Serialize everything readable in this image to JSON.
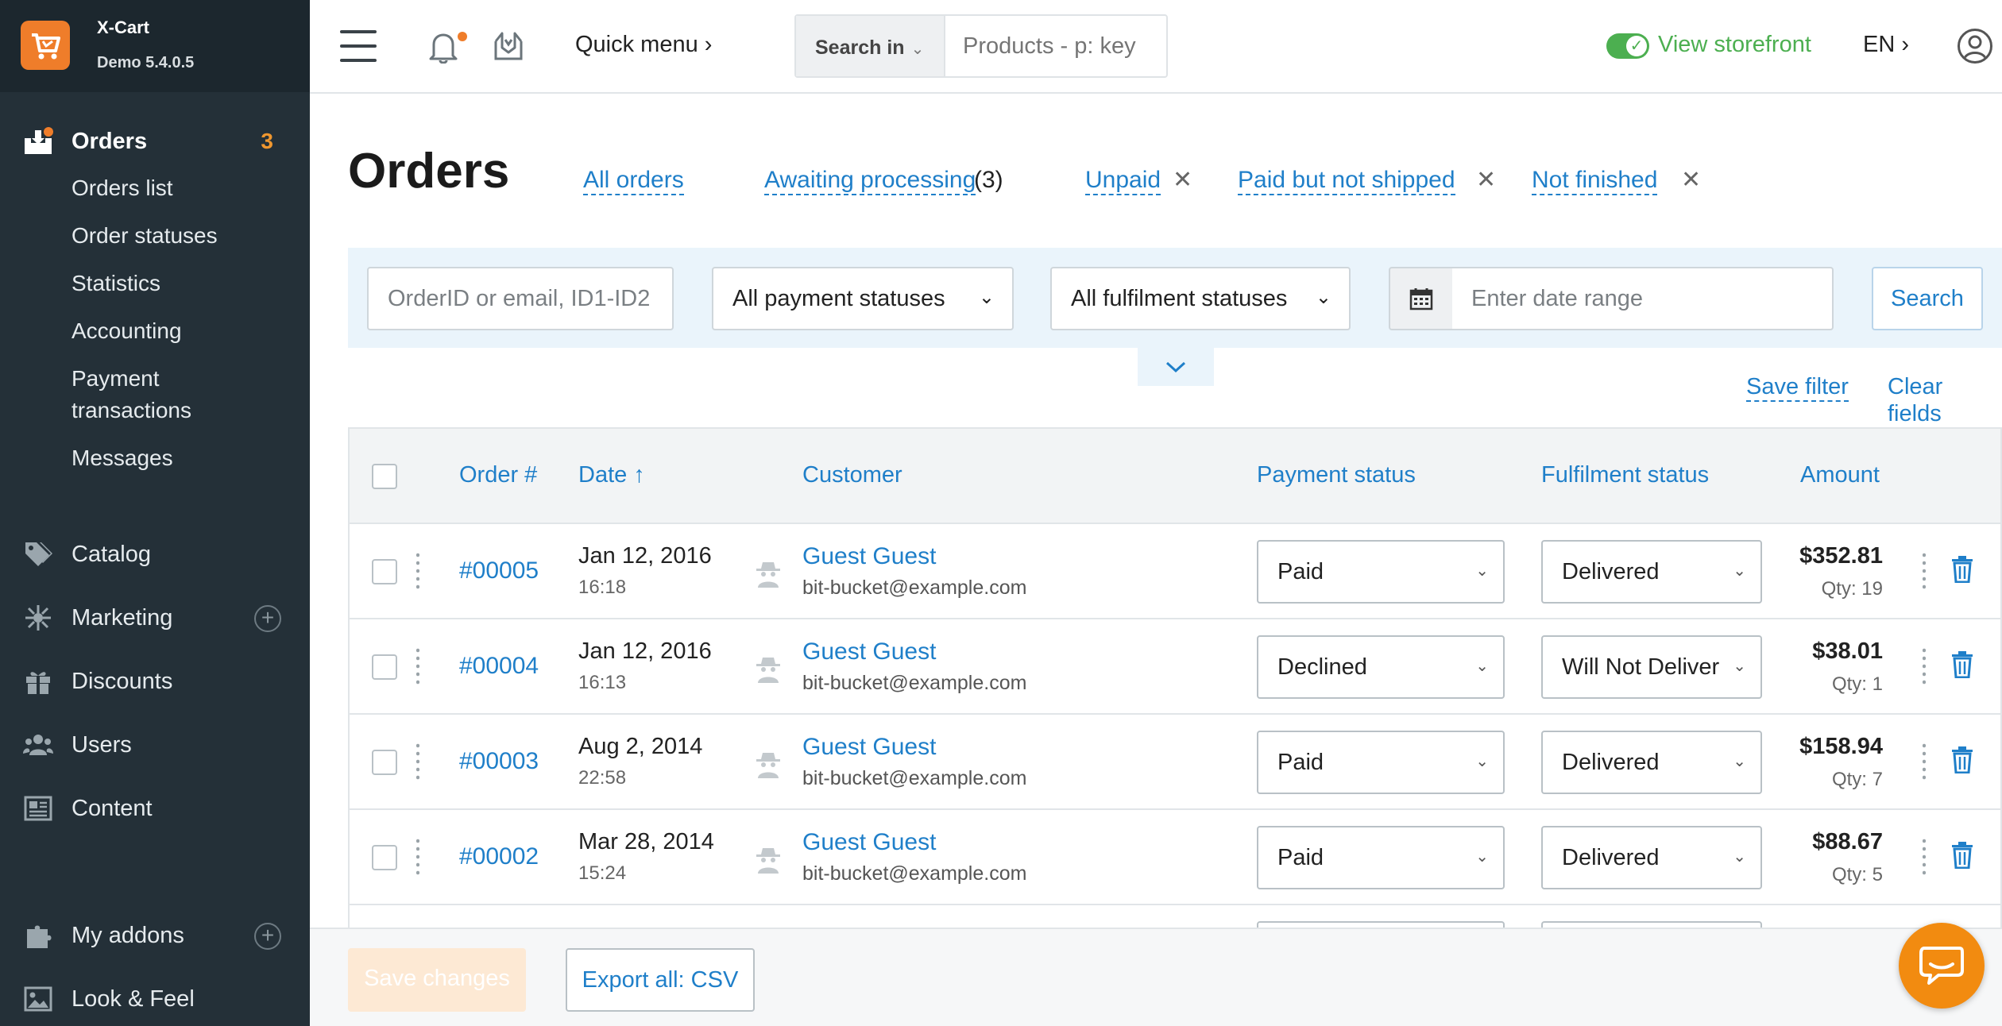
{
  "brand": {
    "name": "X-Cart",
    "version": "Demo 5.4.0.5"
  },
  "sidebar": {
    "orders": {
      "label": "Orders",
      "count": "3"
    },
    "sub_items": [
      "Orders list",
      "Order statuses",
      "Statistics",
      "Accounting",
      "Payment",
      "transactions",
      "Messages"
    ],
    "items": [
      {
        "label": "Catalog"
      },
      {
        "label": "Marketing",
        "plus": "+"
      },
      {
        "label": "Discounts"
      },
      {
        "label": "Users"
      },
      {
        "label": "Content"
      },
      {
        "label": "My addons",
        "plus": "+"
      },
      {
        "label": "Look & Feel"
      }
    ]
  },
  "topbar": {
    "quick_menu": "Quick menu ›",
    "search_in": "Search in",
    "search_caret": "⌄",
    "search_placeholder": "Products - p: key",
    "view_storefront": "View storefront",
    "lang": "EN ›"
  },
  "page": {
    "title": "Orders",
    "tabs": {
      "all": "All orders",
      "awaiting": "Awaiting processing",
      "awaiting_count": "(3)",
      "unpaid": "Unpaid",
      "paid_not_shipped": "Paid but not shipped",
      "not_finished": "Not finished",
      "close": "✕"
    }
  },
  "filters": {
    "order_placeholder": "OrderID or email, ID1-ID2",
    "payment_status": "All payment statuses",
    "fulfilment_status": "All fulfilment statuses",
    "date_placeholder": "Enter date range",
    "search": "Search",
    "save_filter": "Save filter",
    "clear_fields": "Clear fields",
    "chev": "⌄"
  },
  "table": {
    "headers": {
      "order": "Order #",
      "date": "Date ↑",
      "customer": "Customer",
      "payment": "Payment status",
      "fulfilment": "Fulfilment status",
      "amount": "Amount"
    },
    "rows": [
      {
        "order": "#00005",
        "date": "Jan 12, 2016",
        "time": "16:18",
        "name": "Guest Guest",
        "email": "bit-bucket@example.com",
        "payment": "Paid",
        "fulfilment": "Delivered",
        "amount": "$352.81",
        "qty": "Qty: 19"
      },
      {
        "order": "#00004",
        "date": "Jan 12, 2016",
        "time": "16:13",
        "name": "Guest Guest",
        "email": "bit-bucket@example.com",
        "payment": "Declined",
        "fulfilment": "Will Not Deliver",
        "amount": "$38.01",
        "qty": "Qty: 1"
      },
      {
        "order": "#00003",
        "date": "Aug 2, 2014",
        "time": "22:58",
        "name": "Guest Guest",
        "email": "bit-bucket@example.com",
        "payment": "Paid",
        "fulfilment": "Delivered",
        "amount": "$158.94",
        "qty": "Qty: 7"
      },
      {
        "order": "#00002",
        "date": "Mar 28, 2014",
        "time": "15:24",
        "name": "Guest Guest",
        "email": "bit-bucket@example.com",
        "payment": "Paid",
        "fulfilment": "Delivered",
        "amount": "$88.67",
        "qty": "Qty: 5"
      }
    ]
  },
  "bottom": {
    "save_changes": "Save changes",
    "export": "Export all: CSV"
  },
  "colors": {
    "accent": "#1f7fc9",
    "brand": "#ef7d2a",
    "sidebar": "#243038",
    "success": "#4caf50",
    "orders_count": "#f0972f"
  },
  "icons": {
    "orders": "orders-icon",
    "catalog": "tag-icon",
    "marketing": "network-icon",
    "discounts": "gift-icon",
    "users": "users-icon",
    "content": "newspaper-icon",
    "addons": "puzzle-icon",
    "look": "image-icon",
    "bell": "bell-icon",
    "mail": "mail-icon",
    "calendar": "calendar-icon",
    "trash": "trash-icon",
    "chat": "chat-icon"
  }
}
